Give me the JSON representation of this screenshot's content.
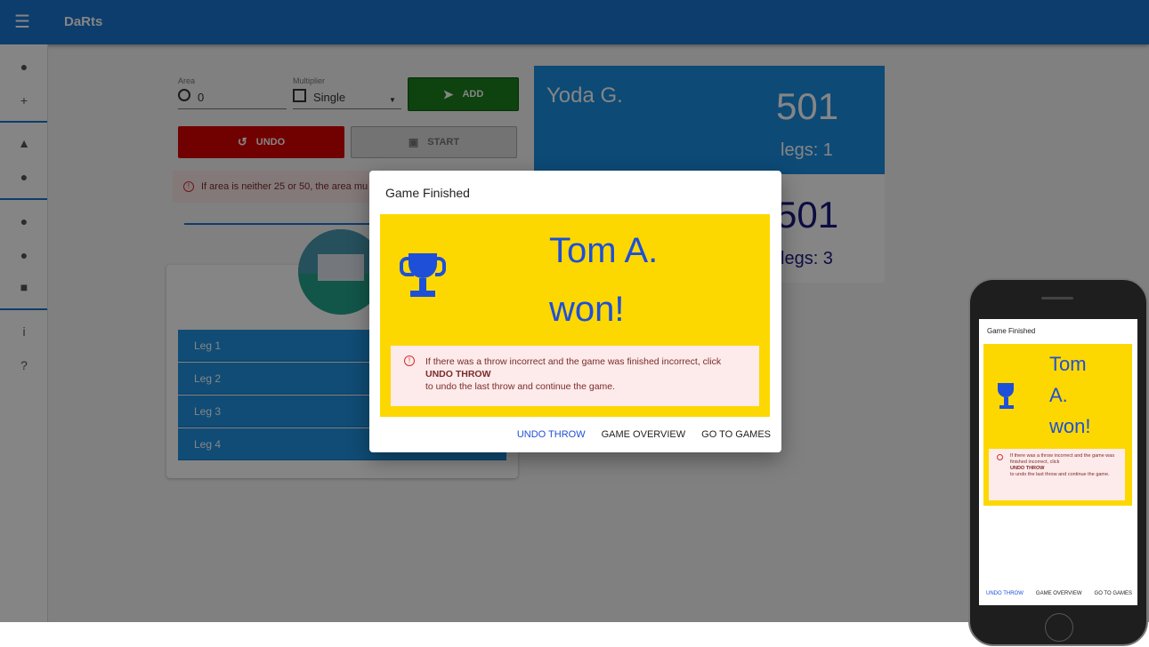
{
  "app": {
    "title": "DaRts"
  },
  "sidebar": {
    "icons": [
      "add-circle-icon",
      "add-person-icon",
      "gamepad-icon",
      "trophy-icon",
      "person-icon",
      "group-icon",
      "archive-icon",
      "info-icon",
      "help-icon"
    ]
  },
  "form": {
    "area_label": "Area",
    "area_value": "0",
    "multiplier_label": "Multiplier",
    "multiplier_value": "Single",
    "add_label": "ADD",
    "undo_label": "UNDO",
    "start_label": "START",
    "alert_text": "If area is neither 25 or 50, the area mu"
  },
  "legs": [
    "Leg 1",
    "Leg 2",
    "Leg 3",
    "Leg 4"
  ],
  "players": [
    {
      "name": "Yoda G.",
      "score": "501",
      "legs": "legs: 1"
    },
    {
      "score": "501",
      "legs": "legs: 3"
    }
  ],
  "dialog": {
    "title": "Game Finished",
    "winner_line1": "Tom A.",
    "winner_line2": "won!",
    "message_pre": "If there was a throw incorrect and the game was finished incorrect, click",
    "message_strong": "UNDO THROW",
    "message_post": "to undo the last throw and continue the game.",
    "actions": {
      "undo": "UNDO THROW",
      "overview": "GAME OVERVIEW",
      "games": "GO TO GAMES"
    }
  },
  "phone": {
    "title": "Game Finished",
    "winner_line1": "Tom",
    "winner_line2": "A.",
    "winner_line3": "won!",
    "message_pre": "If there was a throw incorrect and the game was finished incorrect, click",
    "message_strong": "UNDO THROW",
    "message_post": "to undo the last throw and continue the game.",
    "actions": {
      "undo": "UNDO THROW",
      "overview": "GAME OVERVIEW",
      "games": "GO TO GAMES"
    }
  },
  "colors": {
    "primary": "#1976d2",
    "success": "#1b7f1b",
    "danger": "#d80000",
    "winner_bg": "#fdd800",
    "winner_text": "#1e4fd8",
    "alert_bg": "#fdeaea"
  }
}
